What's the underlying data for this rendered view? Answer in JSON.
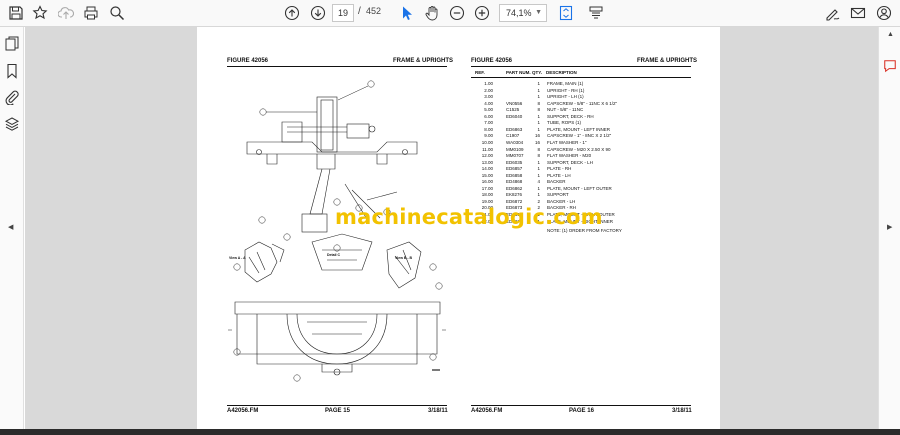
{
  "toolbar": {
    "page_current": "19",
    "page_separator": "/",
    "page_total": "452",
    "zoom": "74,1%",
    "icons": [
      "save-icon",
      "bookmark-star-icon",
      "upload-icon",
      "print-icon",
      "zoom-search-icon",
      "page-up-icon",
      "page-down-icon",
      "select-cursor-icon",
      "hand-pan-icon",
      "zoom-out-icon",
      "zoom-in-icon",
      "fit-page-icon",
      "scroll-mode-icon",
      "sign-icon",
      "email-icon",
      "account-icon"
    ]
  },
  "left_page": {
    "figure": "FIGURE 42056",
    "title": "FRAME & UPRIGHTS",
    "footer_left": "A42056.FM",
    "footer_center": "PAGE 15",
    "footer_right": "3/18/11",
    "view_labels": [
      "View A - A",
      "Detail C",
      "View B - B"
    ]
  },
  "right_page": {
    "figure": "FIGURE 42056",
    "title": "FRAME & UPRIGHTS",
    "columns": {
      "ref": "REF.",
      "part": "PART NUM.",
      "qty": "QTY.",
      "desc": "DESCRIPTION"
    },
    "rows": [
      {
        "ref": "1.00",
        "part": "",
        "qty": "1",
        "desc": "FRAME, MAIN (1)"
      },
      {
        "ref": "2.00",
        "part": "",
        "qty": "1",
        "desc": "UPRIGHT - RH (1)"
      },
      {
        "ref": "3.00",
        "part": "",
        "qty": "1",
        "desc": "UPRIGHT - LH (1)"
      },
      {
        "ref": "4.00",
        "part": "VN0556",
        "qty": "8",
        "desc": "CAPSCREW - 5/8\" - 11NC X 6 1/2\""
      },
      {
        "ref": "5.00",
        "part": "C1525",
        "qty": "8",
        "desc": "NUT - 5/8\" - 11NC"
      },
      {
        "ref": "6.00",
        "part": "ED6040",
        "qty": "1",
        "desc": "SUPPORT, DECK - RH"
      },
      {
        "ref": "7.00",
        "part": "",
        "qty": "1",
        "desc": "TUBE, ROPS (1)"
      },
      {
        "ref": "8.00",
        "part": "ED6863",
        "qty": "1",
        "desc": "PLATE, MOUNT - LEFT INNER"
      },
      {
        "ref": "9.00",
        "part": "C1907",
        "qty": "16",
        "desc": "CAPSCREW - 1\" - 8NC X 2 1/2\""
      },
      {
        "ref": "10.00",
        "part": "WA0304",
        "qty": "16",
        "desc": "FLAT WASHER - 1\""
      },
      {
        "ref": "11.00",
        "part": "MM0109",
        "qty": "8",
        "desc": "CAPSCREW - M20 X 2.50 X 90"
      },
      {
        "ref": "12.00",
        "part": "MM0707",
        "qty": "8",
        "desc": "FLAT WASHER - M20"
      },
      {
        "ref": "13.00",
        "part": "ED6035",
        "qty": "1",
        "desc": "SUPPORT, DECK - LH"
      },
      {
        "ref": "14.00",
        "part": "ED6857",
        "qty": "1",
        "desc": "PLATE - RH"
      },
      {
        "ref": "15.00",
        "part": "ED6858",
        "qty": "1",
        "desc": "PLATE - LH"
      },
      {
        "ref": "16.00",
        "part": "ED4868",
        "qty": "4",
        "desc": "BACKER"
      },
      {
        "ref": "17.00",
        "part": "ED6862",
        "qty": "1",
        "desc": "PLATE, MOUNT - LEFT OUTER"
      },
      {
        "ref": "18.00",
        "part": "EK8276",
        "qty": "1",
        "desc": "SUPPORT"
      },
      {
        "ref": "19.00",
        "part": "ED6872",
        "qty": "2",
        "desc": "BACKER - LH"
      },
      {
        "ref": "20.00",
        "part": "ED6873",
        "qty": "2",
        "desc": "BACKER - RH"
      },
      {
        "ref": "21.00",
        "part": "ED6869",
        "qty": "1",
        "desc": "PLATE, MOUNT - RIGHT OUTER"
      },
      {
        "ref": "22.00",
        "part": "ED6870",
        "qty": "1",
        "desc": "PLATE, MOUNT - RIGHT INNER"
      }
    ],
    "note": "NOTE: (1) ORDER FROM FACTORY",
    "footer_left": "A42056.FM",
    "footer_center": "PAGE 16",
    "footer_right": "3/18/11"
  },
  "watermark": "machinecatalogic.com",
  "colors": {
    "watermark": "#f2c200",
    "viewer_bg": "#d9d9d9",
    "accent": "#1a73e8"
  }
}
